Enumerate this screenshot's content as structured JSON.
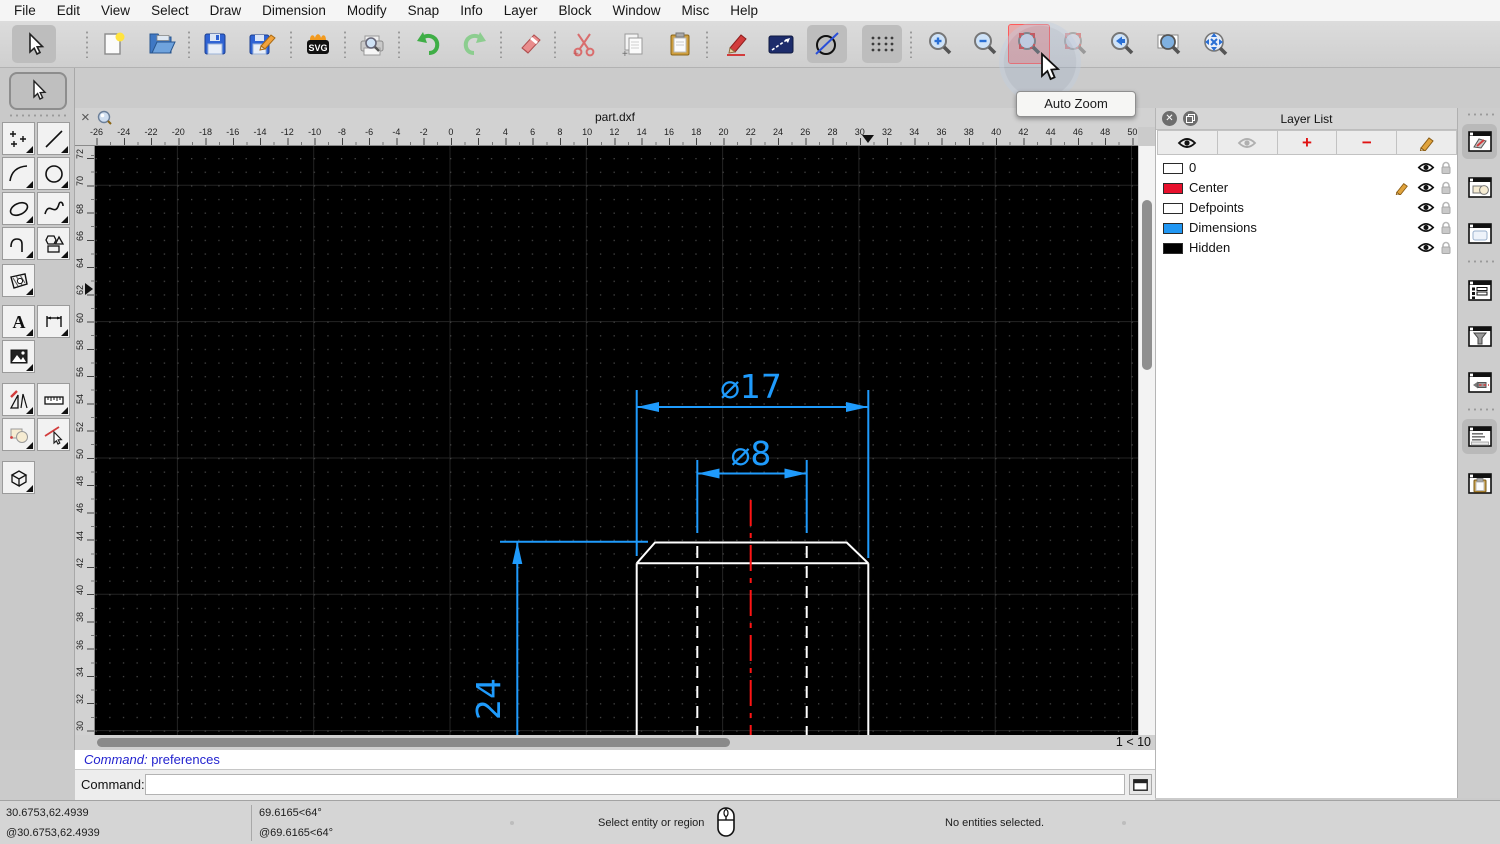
{
  "menu": {
    "items": [
      "File",
      "Edit",
      "View",
      "Select",
      "Draw",
      "Dimension",
      "Modify",
      "Snap",
      "Info",
      "Layer",
      "Block",
      "Window",
      "Misc",
      "Help"
    ]
  },
  "toolbar": {
    "auto_zoom_tooltip": "Auto Zoom"
  },
  "document_tab": {
    "title": "part.dxf",
    "close_glyph": "×"
  },
  "rulers": {
    "horizontal": [
      -26,
      -24,
      -22,
      -20,
      -18,
      -16,
      -14,
      -12,
      -10,
      -8,
      -6,
      -4,
      -2,
      0,
      2,
      4,
      6,
      8,
      10,
      12,
      14,
      16,
      18,
      20,
      22,
      24,
      26,
      28,
      30,
      32,
      34,
      36,
      38,
      40,
      42,
      44,
      46,
      48,
      50
    ],
    "vertical": [
      72,
      70,
      68,
      66,
      64,
      62,
      60,
      58,
      56,
      54,
      52,
      50,
      48,
      46,
      44,
      42,
      40,
      38,
      36,
      34,
      32,
      30
    ]
  },
  "drawing": {
    "dim_outer_diameter": "⌀17",
    "dim_inner_diameter": "⌀8",
    "dim_height": "24"
  },
  "scrollbar": {
    "indicator": "1 < 10"
  },
  "command_panel": {
    "history_prompt": "Command:",
    "history_entry": "preferences",
    "prompt": "Command:",
    "input_value": ""
  },
  "status_bar": {
    "coord_absolute": "30.6753,62.4939",
    "coord_relative": "@30.6753,62.4939",
    "polar_absolute": "69.6165<64°",
    "polar_relative": "@69.6165<64°",
    "hint": "Select entity or region",
    "selection_info": "No entities selected."
  },
  "layer_panel": {
    "title": "Layer List",
    "layers": [
      {
        "name": "0",
        "color": "#ffffff",
        "pencil": false
      },
      {
        "name": "Center",
        "color": "#e8112d",
        "pencil": true
      },
      {
        "name": "Defpoints",
        "color": "#ffffff",
        "pencil": false
      },
      {
        "name": "Dimensions",
        "color": "#2197f3",
        "pencil": false
      },
      {
        "name": "Hidden",
        "color": "#000000",
        "pencil": false
      }
    ]
  },
  "colors": {
    "dimension_blue": "#1f9bfc",
    "centerline_red": "#ff1414",
    "outline_white": "#ffffff",
    "selection_highlight": "#ff5a5a"
  }
}
